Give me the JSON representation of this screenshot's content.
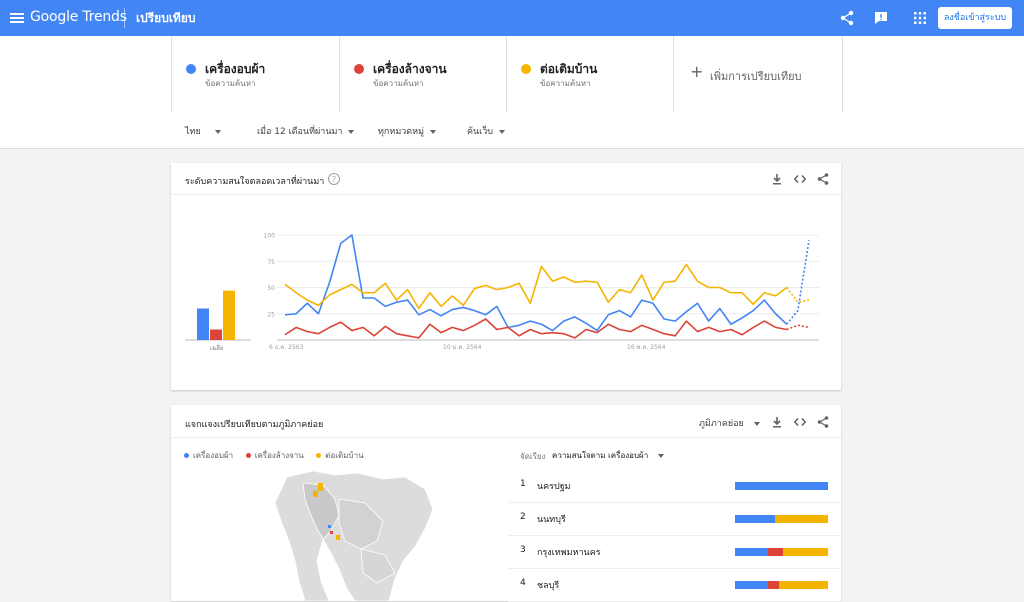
{
  "header": {
    "app_name": "Google Trends",
    "page_title": "เปรียบเทียบ",
    "signin_label": "ลงชื่อเข้าสู่ระบบ"
  },
  "terms": [
    {
      "name": "เครื่องอบผ้า",
      "sub": "ข้อความค้นหา",
      "color": "#4285f4"
    },
    {
      "name": "เครื่องล้างจาน",
      "sub": "ข้อความค้นหา",
      "color": "#db4437"
    },
    {
      "name": "ต่อเติมบ้าน",
      "sub": "ข้อความค้นหา",
      "color": "#f4b400"
    }
  ],
  "add_term_label": "เพิ่มการเปรียบเทียบ",
  "filters": {
    "region": "ไทย",
    "period": "เมื่อ 12 เดือนที่ผ่านมา",
    "category": "ทุกหมวดหมู่",
    "search_type": "ค้นเว็บ"
  },
  "interest_card": {
    "title": "ระดับความสนใจตลอดเวลาที่ผ่านมา",
    "average_label": "เฉลี่ย"
  },
  "chart_data": {
    "type": "line",
    "title": "ระดับความสนใจตลอดเวลาที่ผ่านมา",
    "x_tick_labels": [
      "6 ธ.ค. 2563",
      "10 ม.ค. 2564",
      "16 พ.ค. 2564"
    ],
    "y_ticks": [
      25,
      50,
      75,
      100
    ],
    "ylim": [
      0,
      100
    ],
    "grid": true,
    "averages": [
      30,
      10,
      47
    ],
    "series": [
      {
        "name": "เครื่องอบผ้า",
        "color": "#4285f4",
        "values": [
          24,
          25,
          35,
          25,
          55,
          92,
          100,
          40,
          40,
          32,
          36,
          38,
          24,
          29,
          23,
          29,
          31,
          28,
          24,
          32,
          12,
          14,
          18,
          15,
          9,
          18,
          22,
          16,
          9,
          24,
          28,
          22,
          38,
          35,
          20,
          18,
          27,
          35,
          18,
          30,
          15,
          21,
          28,
          38,
          25,
          15,
          28,
          95
        ]
      },
      {
        "name": "เครื่องล้างจาน",
        "color": "#db4437",
        "values": [
          5,
          12,
          8,
          6,
          12,
          17,
          9,
          12,
          4,
          13,
          6,
          4,
          2,
          15,
          7,
          12,
          9,
          14,
          20,
          10,
          12,
          4,
          10,
          6,
          7,
          6,
          2,
          10,
          7,
          15,
          10,
          8,
          14,
          10,
          6,
          4,
          18,
          8,
          12,
          8,
          10,
          5,
          12,
          18,
          12,
          10,
          14,
          12
        ]
      },
      {
        "name": "ต่อเติมบ้าน",
        "color": "#f4b400",
        "values": [
          53,
          45,
          38,
          33,
          43,
          48,
          53,
          45,
          45,
          54,
          38,
          48,
          30,
          45,
          32,
          42,
          33,
          49,
          52,
          48,
          50,
          54,
          35,
          70,
          56,
          60,
          55,
          56,
          55,
          36,
          48,
          45,
          62,
          38,
          55,
          56,
          72,
          56,
          50,
          50,
          45,
          45,
          34,
          45,
          42,
          50,
          36,
          38
        ]
      }
    ]
  },
  "subregion_card": {
    "title": "แจกแจงเปรียบเทียบตามภูมิภาคย่อย",
    "resolution_label": "ภูมิภาคย่อย",
    "sort_label": "จัดเรียง",
    "sort_value": "ความสนใจตาม เครื่องอบผ้า"
  },
  "regions": [
    {
      "rank": "1",
      "name": "นครปฐม",
      "shares": [
        100,
        0,
        0
      ]
    },
    {
      "rank": "2",
      "name": "นนทบุรี",
      "shares": [
        43,
        0,
        57
      ]
    },
    {
      "rank": "3",
      "name": "กรุงเทพมหานคร",
      "shares": [
        36,
        16,
        48
      ]
    },
    {
      "rank": "4",
      "name": "ชลบุรี",
      "shares": [
        35,
        12,
        53
      ]
    }
  ]
}
